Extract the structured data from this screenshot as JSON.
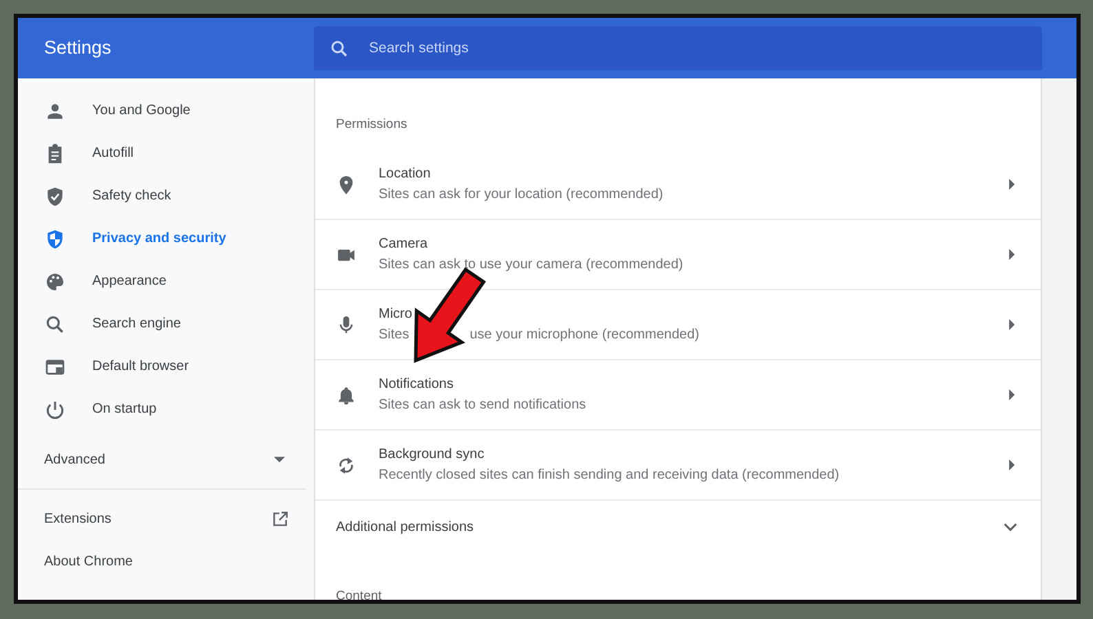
{
  "header": {
    "title": "Settings",
    "search": {
      "placeholder": "Search settings"
    }
  },
  "sidebar": {
    "items": [
      {
        "label": "You and Google",
        "kind": "person",
        "selected": false
      },
      {
        "label": "Autofill",
        "kind": "clipboard",
        "selected": false
      },
      {
        "label": "Safety check",
        "kind": "shield-check",
        "selected": false
      },
      {
        "label": "Privacy and security",
        "kind": "shield",
        "selected": true
      },
      {
        "label": "Appearance",
        "kind": "palette",
        "selected": false
      },
      {
        "label": "Search engine",
        "kind": "search",
        "selected": false
      },
      {
        "label": "Default browser",
        "kind": "browser",
        "selected": false
      },
      {
        "label": "On startup",
        "kind": "power",
        "selected": false
      }
    ],
    "advanced": {
      "label": "Advanced",
      "expanded": false
    },
    "links": [
      {
        "label": "Extensions",
        "kind": "external"
      },
      {
        "label": "About Chrome",
        "kind": "plain"
      }
    ]
  },
  "content": {
    "section_title": "Permissions",
    "rows": [
      {
        "title": "Location",
        "description": [
          "Sites can ask for your location (recommended)"
        ],
        "kind": "pin"
      },
      {
        "title": "Camera",
        "description": [
          "Sites can ask to use your camera (recommended)"
        ],
        "kind": "camera"
      },
      {
        "title": "Micro",
        "description": [
          "Sites",
          "use your microphone (recommended)"
        ],
        "kind": "mic"
      },
      {
        "title": "Notifications",
        "description": [
          "Sites can ask to send notifications"
        ],
        "kind": "bell"
      },
      {
        "title": "Background sync",
        "description": [
          "Recently closed sites can finish sending and receiving data (recommended)"
        ],
        "kind": "sync"
      }
    ],
    "additional": {
      "label": "Additional permissions",
      "expanded": false
    },
    "next_section": "Content"
  }
}
